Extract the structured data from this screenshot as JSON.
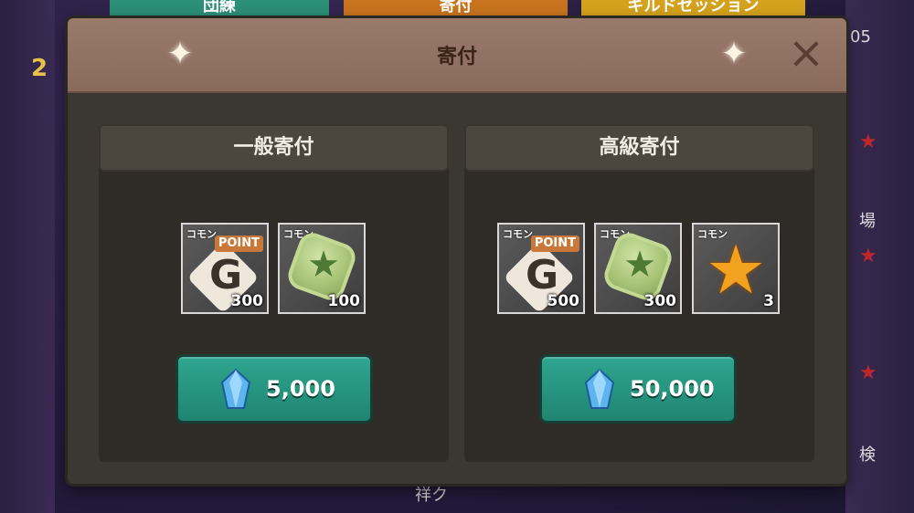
{
  "background": {
    "tabs": [
      "団練",
      "寄付",
      "ギルドセッション"
    ],
    "left_text": "2",
    "right_texts": [
      "05",
      "場",
      "検"
    ],
    "bottom_text": "祥ク"
  },
  "dialog": {
    "title": "寄付",
    "close_icon": "close-icon"
  },
  "donations": [
    {
      "name": "一般寄付",
      "items": [
        {
          "rarity": "コモン",
          "icon": "guild-point-icon",
          "tag": "POINT",
          "letter": "G",
          "qty": "300"
        },
        {
          "rarity": "コモン",
          "icon": "green-star-stone-icon",
          "qty": "100"
        }
      ],
      "cost": "5,000",
      "cost_icon": "blue-gem-icon"
    },
    {
      "name": "高級寄付",
      "items": [
        {
          "rarity": "コモン",
          "icon": "guild-point-icon",
          "tag": "POINT",
          "letter": "G",
          "qty": "500"
        },
        {
          "rarity": "コモン",
          "icon": "green-star-stone-icon",
          "qty": "300"
        },
        {
          "rarity": "コモン",
          "icon": "gold-star-icon",
          "qty": "3"
        }
      ],
      "cost": "50,000",
      "cost_icon": "blue-gem-icon"
    }
  ],
  "colors": {
    "header": "#9a7a6a",
    "button": "#2fa58f",
    "point_tag": "#c9783a"
  }
}
